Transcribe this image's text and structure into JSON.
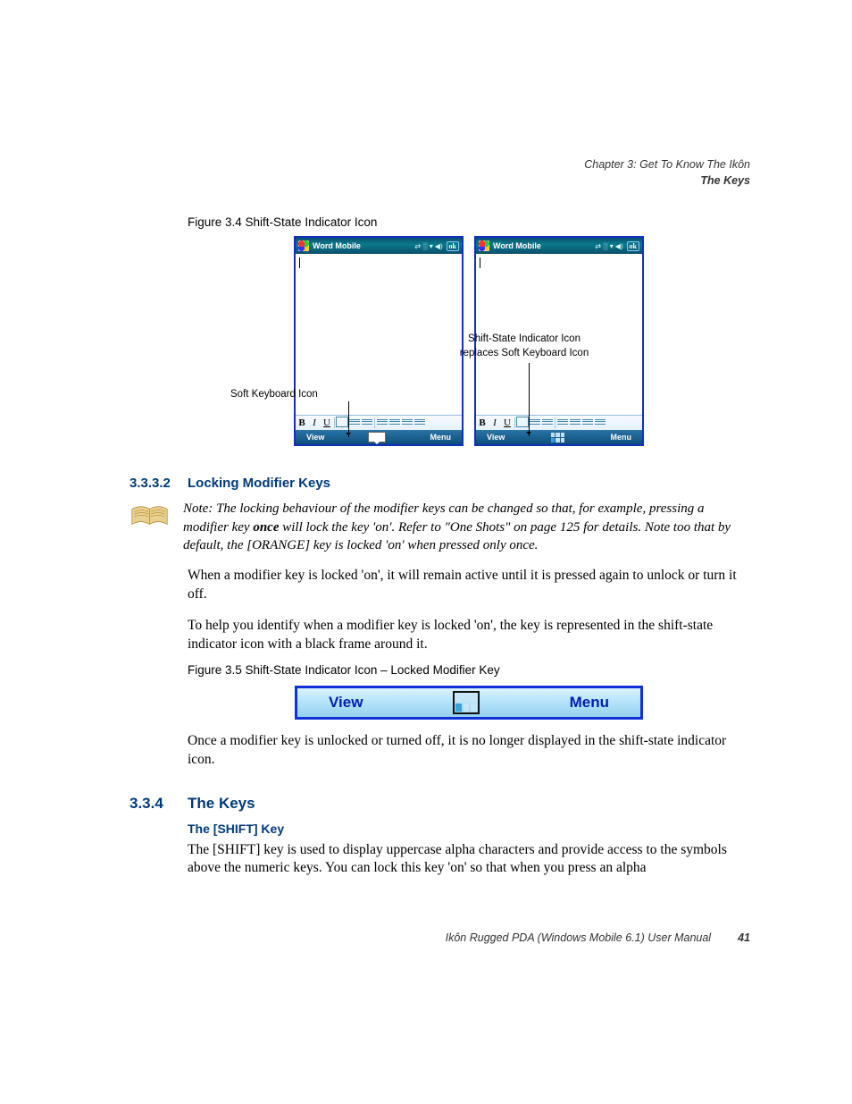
{
  "header": {
    "chapter": "Chapter 3:  Get To Know The Ikôn",
    "section": "The Keys"
  },
  "fig34": {
    "caption": "Figure 3.4  Shift-State Indicator Icon",
    "app_title": "Word Mobile",
    "ok_label": "ok",
    "menubar_left": "View",
    "menubar_right": "Menu",
    "callout_left": "Soft Keyboard Icon",
    "callout_right_l1": "Shift-State Indicator Icon",
    "callout_right_l2": "replaces Soft Keyboard Icon"
  },
  "sec3332": {
    "num": "3.3.3.2",
    "title": "Locking Modifier Keys",
    "note_label": "Note: ",
    "note_p1": "The locking behaviour of the modifier keys can be changed so that, for example, pressing a modifier key ",
    "note_bold": "once",
    "note_p2": " will lock the key 'on'. Refer to \"One Shots\" on page 125 for details. Note too that by default, the [ORANGE] key is locked 'on' when pressed only once.",
    "body1": "When a modifier key is locked 'on', it will remain active until it is pressed again to unlock or turn it off.",
    "body2": "To help you identify when a modifier key is locked 'on', the key is represented in the shift-state indicator icon with a black frame around it."
  },
  "fig35": {
    "caption": "Figure 3.5  Shift-State Indicator Icon – Locked Modifier Key",
    "left": "View",
    "right": "Menu"
  },
  "after35": "Once a modifier key is unlocked or turned off, it is no longer displayed in the shift-state indicator icon.",
  "sec334": {
    "num": "3.3.4",
    "title": "The Keys",
    "subhead": "The [SHIFT] Key",
    "body": "The [SHIFT] key is used to display uppercase alpha characters and provide access to the symbols above the numeric keys. You can lock this key 'on' so that when you press an alpha"
  },
  "footer": {
    "text": "Ikôn Rugged PDA (Windows Mobile 6.1)  User Manual",
    "page": "41"
  }
}
